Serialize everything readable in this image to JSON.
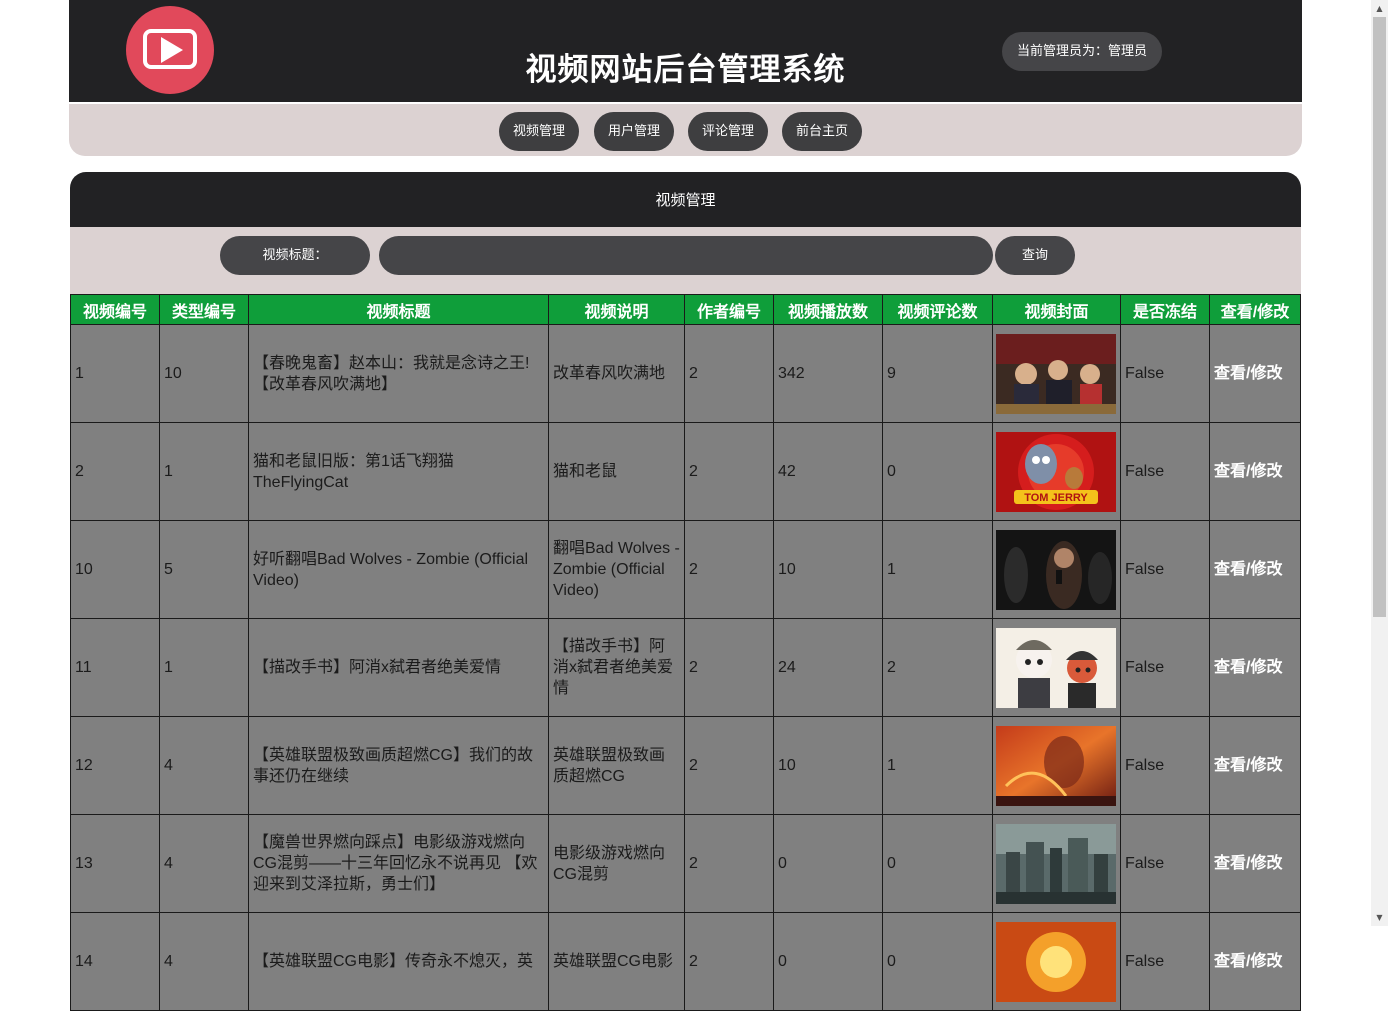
{
  "header": {
    "site_title": "视频网站后台管理系统",
    "admin_label": "当前管理员为：管理员",
    "logo_icon": "play-button-icon",
    "accent": "#e1495b"
  },
  "nav": {
    "items": [
      {
        "label": "视频管理"
      },
      {
        "label": "用户管理"
      },
      {
        "label": "评论管理"
      },
      {
        "label": "前台主页"
      }
    ]
  },
  "panel": {
    "title": "视频管理"
  },
  "search": {
    "label": "视频标题：",
    "value": "",
    "button": "查询"
  },
  "table": {
    "columns": [
      "视频编号",
      "类型编号",
      "视频标题",
      "视频说明",
      "作者编号",
      "视频播放数",
      "视频评论数",
      "视频封面",
      "是否冻结",
      "查看/修改"
    ],
    "header_color": "#0f9e3a",
    "rows": [
      {
        "id": "1",
        "type": "10",
        "title": "【春晚鬼畜】赵本山：我就是念诗之王!【改革春风吹满地】",
        "desc": "改革春风吹满地",
        "author": "2",
        "plays": "342",
        "comments": "9",
        "cover": "cover-studio",
        "frozen": "False",
        "action": "查看/修改"
      },
      {
        "id": "2",
        "type": "1",
        "title": "猫和老鼠旧版：第1话飞翔猫 TheFlyingCat",
        "desc": "猫和老鼠",
        "author": "2",
        "plays": "42",
        "comments": "0",
        "cover": "cover-tomjerry",
        "frozen": "False",
        "action": "查看/修改"
      },
      {
        "id": "10",
        "type": "5",
        "title": "好听翻唱Bad Wolves - Zombie (Official Video)",
        "desc": "翻唱Bad Wolves - Zombie (Official Video)",
        "author": "2",
        "plays": "10",
        "comments": "1",
        "cover": "cover-concert",
        "frozen": "False",
        "action": "查看/修改"
      },
      {
        "id": "11",
        "type": "1",
        "title": "【描改手书】阿消x弑君者绝美爱情",
        "desc": "【描改手书】阿消x弑君者绝美爱情",
        "author": "2",
        "plays": "24",
        "comments": "2",
        "cover": "cover-anime",
        "frozen": "False",
        "action": "查看/修改"
      },
      {
        "id": "12",
        "type": "4",
        "title": "【英雄联盟极致画质超燃CG】我们的故事还仍在继续",
        "desc": "英雄联盟极致画质超燃CG",
        "author": "2",
        "plays": "10",
        "comments": "1",
        "cover": "cover-fire",
        "frozen": "False",
        "action": "查看/修改"
      },
      {
        "id": "13",
        "type": "4",
        "title": "【魔兽世界燃向踩点】电影级游戏燃向CG混剪——十三年回忆永不说再见 【欢迎来到艾泽拉斯，勇士们】",
        "desc": "电影级游戏燃向CG混剪",
        "author": "2",
        "plays": "0",
        "comments": "0",
        "cover": "cover-city",
        "frozen": "False",
        "action": "查看/修改"
      },
      {
        "id": "14",
        "type": "4",
        "title": "【英雄联盟CG电影】传奇永不熄灭，英",
        "desc": "英雄联盟CG电影",
        "author": "2",
        "plays": "0",
        "comments": "0",
        "cover": "cover-blaze",
        "frozen": "False",
        "action": "查看/修改"
      }
    ]
  }
}
